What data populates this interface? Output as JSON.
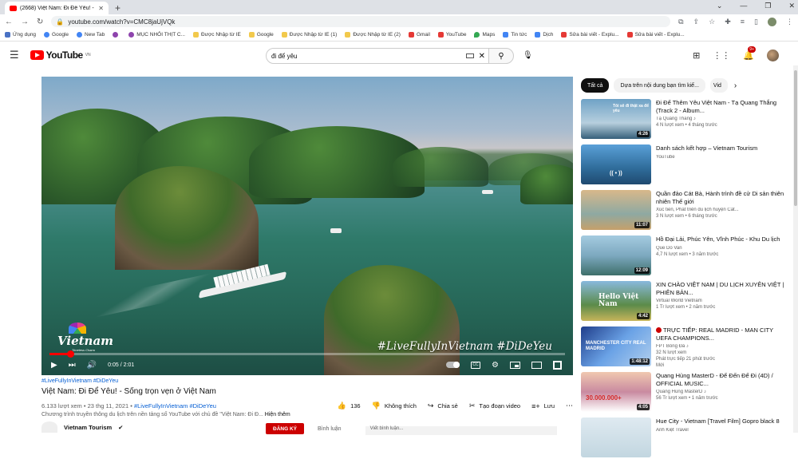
{
  "browser": {
    "tab_title": "(2668) Việt Nam: Đi Để Yêu! - Số...",
    "url": "youtube.com/watch?v=CMC8jaUjVQk",
    "bookmarks": [
      "Ứng dụng",
      "Google",
      "New Tab",
      "",
      "MỤC NHỎI THỊT C...",
      "Được Nhập từ IE",
      "Google",
      "Được Nhập từ IE (1)",
      "Được Nhập từ IE (2)",
      "Gmail",
      "YouTube",
      "Maps",
      "Tin tức",
      "Dịch",
      "Sửa bài viết - Explu...",
      "Sửa bài viết - Explu..."
    ]
  },
  "header": {
    "logo": "YouTube",
    "country": "VN",
    "search_value": "đi để yêu",
    "notification_count": "9+"
  },
  "player": {
    "current_time": "0:05",
    "duration": "2:01",
    "overlay_hashtags": "#LiveFullyInVietnam #DiDeYeu",
    "logo_name": "Vietnam",
    "logo_sub": "Timeless Charm",
    "progress": 0.04
  },
  "video": {
    "tags": "#LiveFullyInVietnam #DiDeYeu",
    "title": "Việt Nam: Đi Để Yêu! - Sống trọn vẹn ở Việt Nam",
    "views_date": "6.133 lượt xem • 23 thg 11, 2021 •",
    "meta_tags": "#LiveFullyInVietnam #DiDeYeu",
    "desc": "Chương trình truyền thông du lịch trên nền tảng số YouTube với chủ đề \"Việt Nam: Đi Đ...",
    "show_more": "Hiện thêm",
    "likes": "136",
    "dislike": "Không thích",
    "share": "Chia sẻ",
    "clip": "Tạo đoạn video",
    "save": "Lưu",
    "channel": "Vietnam Tourism",
    "subscribe": "ĐĂNG KÝ",
    "comments_label": "Bình luận",
    "comment_placeholder": "Viết bình luận..."
  },
  "sidebar": {
    "chips": [
      "Tất cả",
      "Dựa trên nội dung bạn tìm kiế...",
      "Vid"
    ],
    "items": [
      {
        "title": "Đi Để Thêm Yêu Việt Nam - Tạ Quang Thắng (Track 2 - Album...",
        "channel": "Tạ Quang Thắng ♪",
        "meta": "4 N lượt xem • 4 tháng trước",
        "duration": "4:26",
        "thumb_text": "Tôi sẽ đi thật xa để yêu"
      },
      {
        "title": "Danh sách kết hợp – Vietnam Tourism",
        "channel": "YouTube",
        "meta": "",
        "duration": "",
        "thumb_text": "(( • ))"
      },
      {
        "title": "Quần đảo Cát Bà, Hành trình đề cử Di sản thiên nhiên Thế giới",
        "channel": "Xúc tiến, Phát triển du lịch huyện Cát...",
        "meta": "3 N lượt xem • 6 tháng trước",
        "duration": "11:07",
        "thumb_text": ""
      },
      {
        "title": "Hồ Đại Lải, Phúc Yên, Vĩnh Phúc - Khu Du lịch",
        "channel": "Que Do Van",
        "meta": "4,7 N lượt xem • 3 năm trước",
        "duration": "12:09",
        "thumb_text": ""
      },
      {
        "title": "XIN CHÀO VIỆT NAM | DU LỊCH XUYÊN VIỆT | PHIÊN BẢN...",
        "channel": "Virtual World Vietnam",
        "meta": "1 Tr lượt xem • 2 năm trước",
        "duration": "4:42",
        "thumb_text": "Hello Việt Nam"
      },
      {
        "title": "TRỰC TIẾP: REAL MADRID - MAN CITY UEFA CHAMPIONS...",
        "channel": "FPT Bóng Đá ♪",
        "meta": "32 N lượt xem",
        "meta2": "Phát trực tiếp 21 phút trước",
        "badge": "Mới",
        "duration": "1:48:12",
        "thumb_text": "MANCHESTER CITY REAL MADRID"
      },
      {
        "title": "Quang Hùng MasterD - Để Đến Để Đi (4D) / OFFICIAL MUSIC...",
        "channel": "Quang Hùng MasterD ♪",
        "meta": "56 Tr lượt xem • 1 năm trước",
        "duration": "4:05",
        "thumb_text": "30.000.000+"
      },
      {
        "title": "Hue City - Vietnam [Travel Film] Gopro black 8",
        "channel": "Anh Kiệt Travel",
        "meta": "",
        "duration": "",
        "thumb_text": ""
      }
    ]
  },
  "colors": {
    "yt_red": "#ff0000",
    "link_blue": "#065fd4",
    "subscribe_red": "#cc0000"
  }
}
